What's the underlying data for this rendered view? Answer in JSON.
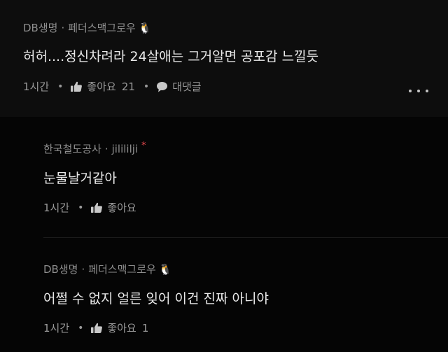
{
  "comments": [
    {
      "author": "DB생명",
      "separator": "·",
      "team": "페더스맥그로우",
      "badge_icon": "penguin-icon",
      "text": "허허....정신차려라 24살애는 그거알면 공포감 느낄듯",
      "time": "1시간",
      "like_label": "좋아요",
      "like_count": "21",
      "reply_label": "대댓글",
      "more_icon": "more-options-icon"
    },
    {
      "author": "한국철도공사",
      "separator": "·",
      "team": "jilililji",
      "badge_icon": "red-star-icon",
      "text": "눈물날거같아",
      "time": "1시간",
      "like_label": "좋아요",
      "like_count": ""
    },
    {
      "author": "DB생명",
      "separator": "·",
      "team": "페더스맥그로우",
      "badge_icon": "penguin-icon",
      "text": "어쩔 수 없지 얼른 잊어 이건 진짜 아니야",
      "time": "1시간",
      "like_label": "좋아요",
      "like_count": "1"
    }
  ],
  "colors": {
    "top_comment_bg": "#0d0d0d",
    "reply_bg": "#050505",
    "badge_red": "#e5484d"
  }
}
